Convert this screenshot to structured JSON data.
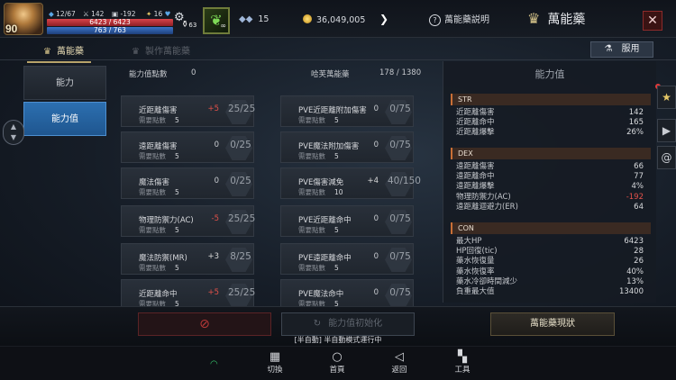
{
  "hud": {
    "level": "90",
    "small_stat_1": "12/67",
    "small_stat_2": "142",
    "small_stat_3": "-192",
    "small_stat_4": "16",
    "hp_text": "6423 / 6423",
    "mp_text": "763 / 763",
    "potion_count": "63",
    "skill_label": "∞",
    "crystals": "15",
    "gold": "36,049,005",
    "help_label": "萬能藥説明",
    "page_title": "萬能藥",
    "close_label": "✕"
  },
  "tabs": [
    {
      "label": "萬能藥"
    },
    {
      "label": "製作萬能藥"
    }
  ],
  "use_button": "服用",
  "side_menu": [
    {
      "label": "能力"
    },
    {
      "label": "能力值"
    }
  ],
  "summary": {
    "points_label": "能力值點數",
    "points_value": "0",
    "elixir_label": "哈芙萬能藥",
    "elixir_value": "178 / 1380"
  },
  "cards_left": [
    {
      "name": "近距離傷害",
      "req_label": "需要點數",
      "req": "5",
      "bonus": "+5",
      "level": "25/25"
    },
    {
      "name": "遠距離傷害",
      "req_label": "需要點數",
      "req": "5",
      "bonus": "0",
      "level": "0/25"
    },
    {
      "name": "魔法傷害",
      "req_label": "需要點數",
      "req": "5",
      "bonus": "0",
      "level": "0/25"
    },
    {
      "name": "物理防禦力(AC)",
      "req_label": "需要點數",
      "req": "5",
      "bonus": "-5",
      "level": "25/25"
    },
    {
      "name": "魔法防禦(MR)",
      "req_label": "需要點數",
      "req": "5",
      "bonus": "+3",
      "level": "8/25"
    },
    {
      "name": "近距離命中",
      "req_label": "需要點數",
      "req": "5",
      "bonus": "+5",
      "level": "25/25"
    }
  ],
  "cards_right": [
    {
      "name": "PVE近距離附加傷害",
      "req_label": "需要點數",
      "req": "5",
      "bonus": "0",
      "level": "0/75"
    },
    {
      "name": "PVE魔法附加傷害",
      "req_label": "需要點數",
      "req": "5",
      "bonus": "0",
      "level": "0/75"
    },
    {
      "name": "PVE傷害減免",
      "req_label": "需要點數",
      "req": "10",
      "bonus": "+4",
      "level": "40/150"
    },
    {
      "name": "PVE近距離命中",
      "req_label": "需要點數",
      "req": "5",
      "bonus": "0",
      "level": "0/75"
    },
    {
      "name": "PVE遠距離命中",
      "req_label": "需要點數",
      "req": "5",
      "bonus": "0",
      "level": "0/75"
    },
    {
      "name": "PVE魔法命中",
      "req_label": "需要點數",
      "req": "5",
      "bonus": "0",
      "level": "0/75"
    }
  ],
  "stat_panel": {
    "title": "能力值",
    "str": {
      "title": "STR",
      "rows": [
        {
          "k": "近距離傷害",
          "v": "142"
        },
        {
          "k": "近距離命中",
          "v": "165"
        },
        {
          "k": "近距離爆擊",
          "v": "26%"
        }
      ]
    },
    "dex": {
      "title": "DEX",
      "rows": [
        {
          "k": "遠距離傷害",
          "v": "66"
        },
        {
          "k": "遠距離命中",
          "v": "77"
        },
        {
          "k": "遠距離爆擊",
          "v": "4%"
        },
        {
          "k": "物理防禦力(AC)",
          "v": "-192"
        },
        {
          "k": "遠距離迴避力(ER)",
          "v": "64"
        }
      ]
    },
    "con": {
      "title": "CON",
      "rows": [
        {
          "k": "最大HP",
          "v": "6423"
        },
        {
          "k": "HP回復(tic)",
          "v": "28"
        },
        {
          "k": "藥水恢復量",
          "v": "26"
        },
        {
          "k": "藥水恢復率",
          "v": "40%"
        },
        {
          "k": "藥水冷卻時間減少",
          "v": "13%"
        },
        {
          "k": "負重最大值",
          "v": "13400"
        }
      ]
    }
  },
  "bottom": {
    "reset_label": "能力值初始化",
    "status_label": "萬能藥現狀",
    "system_message": "[半自動] 半自動模式運行中"
  },
  "navbar": [
    {
      "label": "切換"
    },
    {
      "label": "首頁"
    },
    {
      "label": "返回"
    },
    {
      "label": "工具"
    }
  ],
  "colors": {
    "accent_blue": "#2c6fb0",
    "gold_text": "#e8dcb4",
    "negative": "#e2514a",
    "str_section": "#c96f36"
  }
}
